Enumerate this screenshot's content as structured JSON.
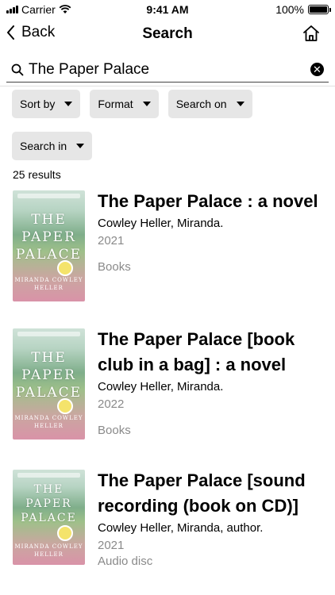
{
  "status_bar": {
    "carrier": "Carrier",
    "time": "9:41 AM",
    "battery": "100%"
  },
  "nav": {
    "back_label": "Back",
    "title": "Search"
  },
  "search": {
    "value": "The Paper Palace"
  },
  "filters": [
    "Sort by",
    "Format",
    "Search on",
    "Search in"
  ],
  "result_count": "25 results",
  "results": [
    {
      "title": "The Paper Palace : a novel",
      "author": "Cowley Heller, Miranda.",
      "year": "2021",
      "format": "Books"
    },
    {
      "title": "The Paper Palace [book club in a bag] : a novel",
      "author": "Cowley Heller, Miranda.",
      "year": "2022",
      "format": "Books"
    },
    {
      "title": "The Paper Palace [sound recording (book on CD)]",
      "author": "Cowley Heller, Miranda, author.",
      "year": "2021",
      "format": "Audio disc"
    }
  ],
  "cover": {
    "title": "THE PAPER PALACE",
    "author": "MIRANDA COWLEY HELLER"
  },
  "colors": {
    "chip_bg": "#e6e6e6",
    "muted_text": "#8a8a8a"
  },
  "icons": [
    "signal-icon",
    "wifi-icon",
    "battery-icon",
    "chevron-left-icon",
    "home-icon",
    "search-icon",
    "clear-icon",
    "caret-down-icon"
  ]
}
